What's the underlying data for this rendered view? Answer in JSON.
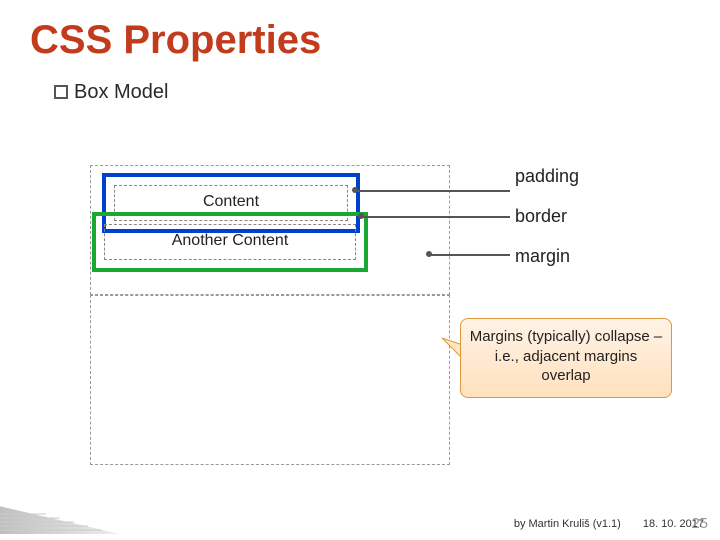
{
  "title": "CSS Properties",
  "section": {
    "bullet_label": "Box Model"
  },
  "box1": {
    "content_label": "Content"
  },
  "box2": {
    "content_label": "Another Content"
  },
  "labels": {
    "padding": "padding",
    "border": "border",
    "margin": "margin"
  },
  "callout": {
    "text": "Margins (typically) collapse – i.e., adjacent margins overlap"
  },
  "footer": {
    "byline": "by Martin Kruliš (v1.1)",
    "date": "18. 10. 2017",
    "page": "25"
  }
}
